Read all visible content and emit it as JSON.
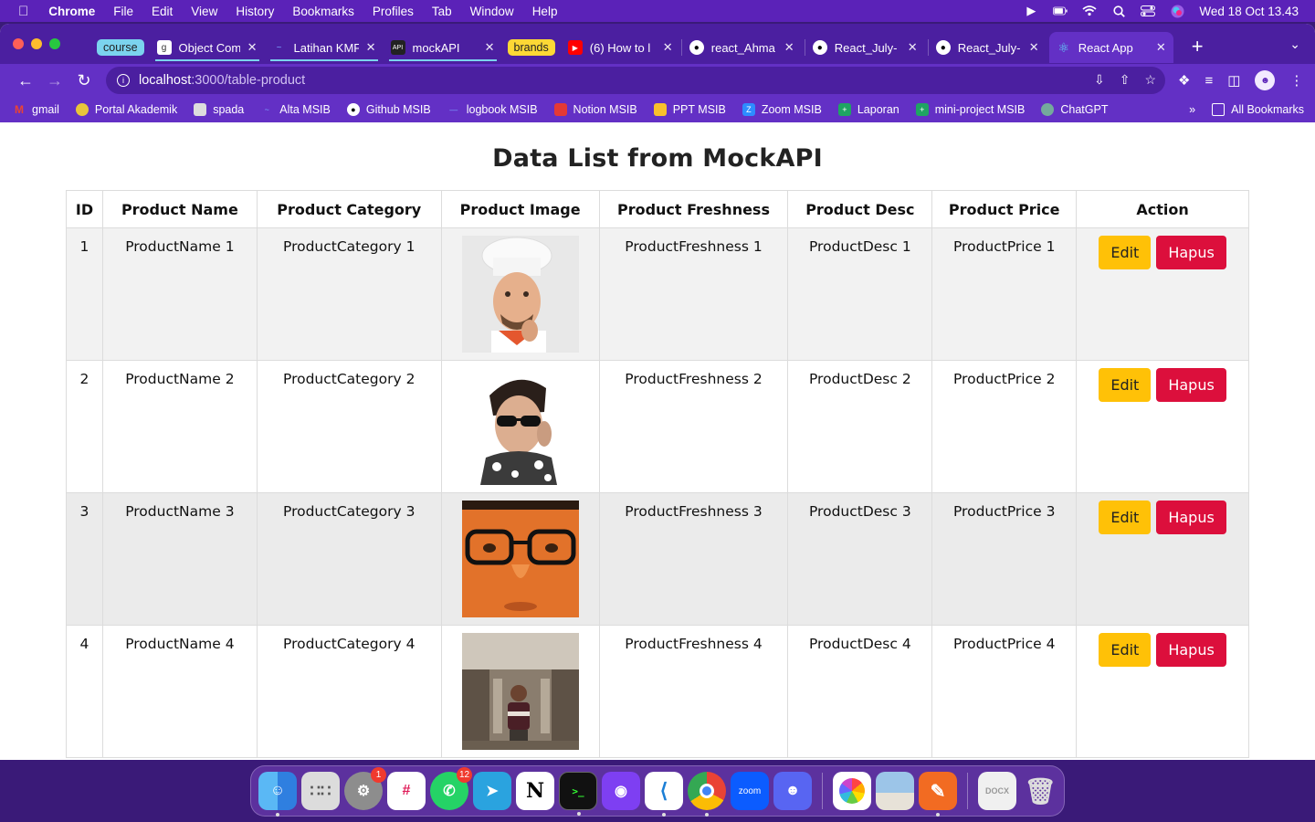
{
  "menubar": {
    "app": "Chrome",
    "items": [
      "File",
      "Edit",
      "View",
      "History",
      "Bookmarks",
      "Profiles",
      "Tab",
      "Window",
      "Help"
    ],
    "datetime": "Wed 18 Oct  13.43"
  },
  "tabs": {
    "group1_label": "course",
    "group2_label": "brands",
    "t1": "Object Com",
    "t2": "Latihan KMF",
    "t3": "mockAPI",
    "t4": "(6) How to l",
    "t5": "react_Ahma",
    "t6": "React_July-",
    "t7": "React_July-",
    "t8": "React App"
  },
  "toolbar": {
    "url_host": "localhost",
    "url_path": ":3000/table-product"
  },
  "bookmarks": [
    "gmail",
    "Portal Akademik",
    "spada",
    "Alta MSIB",
    "Github MSIB",
    "logbook MSIB",
    "Notion MSIB",
    "PPT MSIB",
    "Zoom MSIB",
    "Laporan",
    "mini-project MSIB",
    "ChatGPT"
  ],
  "bookmarks_all": "All Bookmarks",
  "page": {
    "title": "Data List from MockAPI",
    "headers": [
      "ID",
      "Product Name",
      "Product Category",
      "Product Image",
      "Product Freshness",
      "Product Desc",
      "Product Price",
      "Action"
    ],
    "edit_label": "Edit",
    "delete_label": "Hapus",
    "rows": [
      {
        "id": "1",
        "name": "ProductName 1",
        "category": "ProductCategory 1",
        "freshness": "ProductFreshness 1",
        "desc": "ProductDesc 1",
        "price": "ProductPrice 1"
      },
      {
        "id": "2",
        "name": "ProductName 2",
        "category": "ProductCategory 2",
        "freshness": "ProductFreshness 2",
        "desc": "ProductDesc 2",
        "price": "ProductPrice 2"
      },
      {
        "id": "3",
        "name": "ProductName 3",
        "category": "ProductCategory 3",
        "freshness": "ProductFreshness 3",
        "desc": "ProductDesc 3",
        "price": "ProductPrice 3"
      },
      {
        "id": "4",
        "name": "ProductName 4",
        "category": "ProductCategory 4",
        "freshness": "ProductFreshness 4",
        "desc": "ProductDesc 4",
        "price": "ProductPrice 4"
      }
    ]
  },
  "dock": {
    "system_settings_badge": "1",
    "whatsapp_badge": "12",
    "zoom_label": "zoom"
  }
}
